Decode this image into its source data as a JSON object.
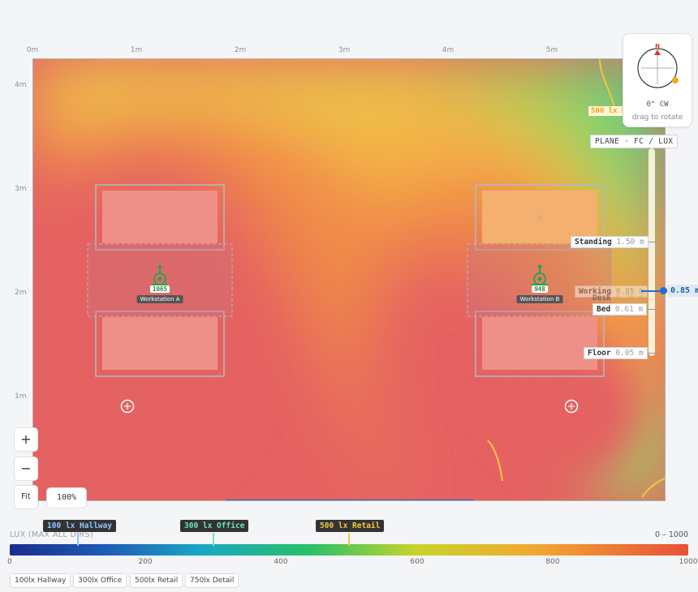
{
  "ruler": {
    "x_labels": [
      "0m",
      "1m",
      "2m",
      "3m",
      "4m",
      "5m"
    ],
    "y_labels": [
      "4m",
      "3m",
      "2m",
      "1m"
    ]
  },
  "workstations": [
    {
      "name": "Workstation A",
      "value": "1065"
    },
    {
      "name": "Workstation B",
      "value": "948"
    }
  ],
  "contour_label": "500 lx Retail",
  "compass": {
    "north": "N",
    "rotation": "0° CW",
    "hint": "drag to rotate"
  },
  "plane": {
    "title": "PLANE · FC / LUX",
    "marks": [
      {
        "name": "Standing",
        "value": "1.50 m"
      },
      {
        "name": "Working",
        "value": "0.85 m"
      },
      {
        "name": "Desk",
        "value": "0.76 m"
      },
      {
        "name": "Bed",
        "value": "0.61 m"
      },
      {
        "name": "Floor",
        "value": "0.05 m"
      }
    ],
    "current": "0.85 m"
  },
  "zoom": {
    "in": "+",
    "out": "−",
    "fit": "Fit",
    "level": "100%"
  },
  "legend": {
    "title": "LUX (MAX ALL DIRS)",
    "range": "0 – 1000",
    "ticks": [
      "0",
      "200",
      "400",
      "600",
      "800",
      "1000"
    ],
    "thresholds": [
      {
        "label": "100 lx Hallway",
        "value": 100,
        "color": "#8ec5ff"
      },
      {
        "label": "300 lx Office",
        "value": 300,
        "color": "#6ee7b7"
      },
      {
        "label": "500 lx Retail",
        "value": 500,
        "color": "#f5c542"
      }
    ],
    "presets": [
      "100lx Hallway",
      "300lx Office",
      "500lx Retail",
      "750lx Detail"
    ]
  },
  "colors": {
    "accent": "#1f6fd1",
    "heat_high": "#e35d5d",
    "heat_low": "#4fd07d"
  }
}
